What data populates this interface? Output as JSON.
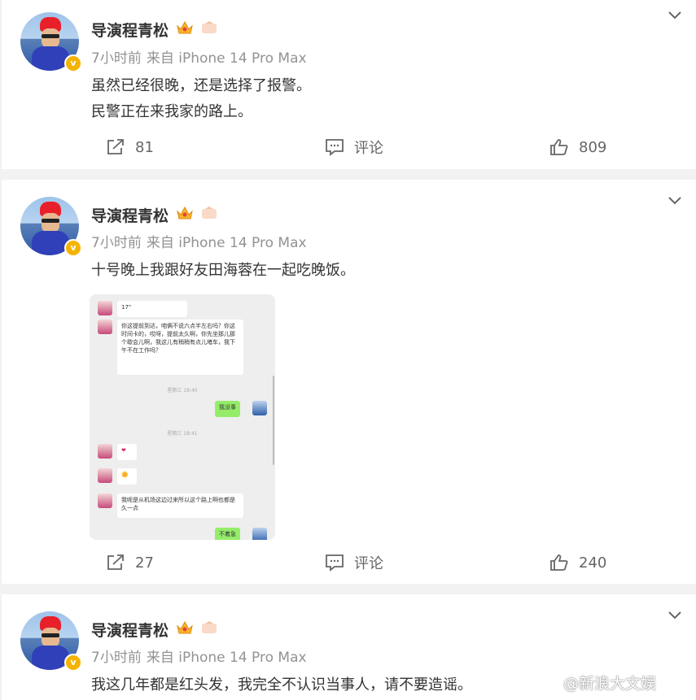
{
  "posts": [
    {
      "user": {
        "name": "导演程青松",
        "verified_badge": "v"
      },
      "meta": {
        "time": "7小时前",
        "source": "来自 iPhone 14 Pro Max"
      },
      "text": [
        "虽然已经很晚，还是选择了报警。",
        "民警正在来我家的路上。"
      ],
      "actions": {
        "repost_count": "81",
        "comment_label": "评论",
        "like_count": "809"
      }
    },
    {
      "user": {
        "name": "导演程青松",
        "verified_badge": "v"
      },
      "meta": {
        "time": "7小时前",
        "source": "来自 iPhone 14 Pro Max"
      },
      "text": [
        "十号晚上我跟好友田海蓉在一起吃晚饭。"
      ],
      "screenshot": {
        "voice": "17\"",
        "msg1": "你这提前到达，咱俩不说六点半左右吗？你这时间卡的，哎呀，提前太久啊，你先坐那儿那个歇会儿啊，我这儿有稍稍有点儿堵车，我下午不在工作吗？",
        "ts1": "星期三 18:40",
        "reply1": "我没事",
        "ts2": "星期三 18:41",
        "heart": "❤",
        "flower": "🌼",
        "msg2": "我呢是从机场这边过来所以这个路上啊也都是久一点",
        "reply2": "不着急"
      },
      "actions": {
        "repost_count": "27",
        "comment_label": "评论",
        "like_count": "240"
      }
    },
    {
      "user": {
        "name": "导演程青松",
        "verified_badge": "v"
      },
      "meta": {
        "time": "7小时前",
        "source": "来自 iPhone 14 Pro Max"
      },
      "text": [
        "我这几年都是红头发，我完全不认识当事人，请不要造谣。"
      ]
    }
  ],
  "watermark": "@新浪大文娱",
  "colors": {
    "page_bg": "#f2f2f2",
    "card_bg": "#ffffff",
    "meta_gray": "#939393",
    "chat_green": "#95ec69",
    "verified_gold": "#f5b300"
  },
  "icons": [
    "chevron-down-icon",
    "crown-icon",
    "fan-badge-icon",
    "repost-icon",
    "comment-icon",
    "like-icon"
  ]
}
